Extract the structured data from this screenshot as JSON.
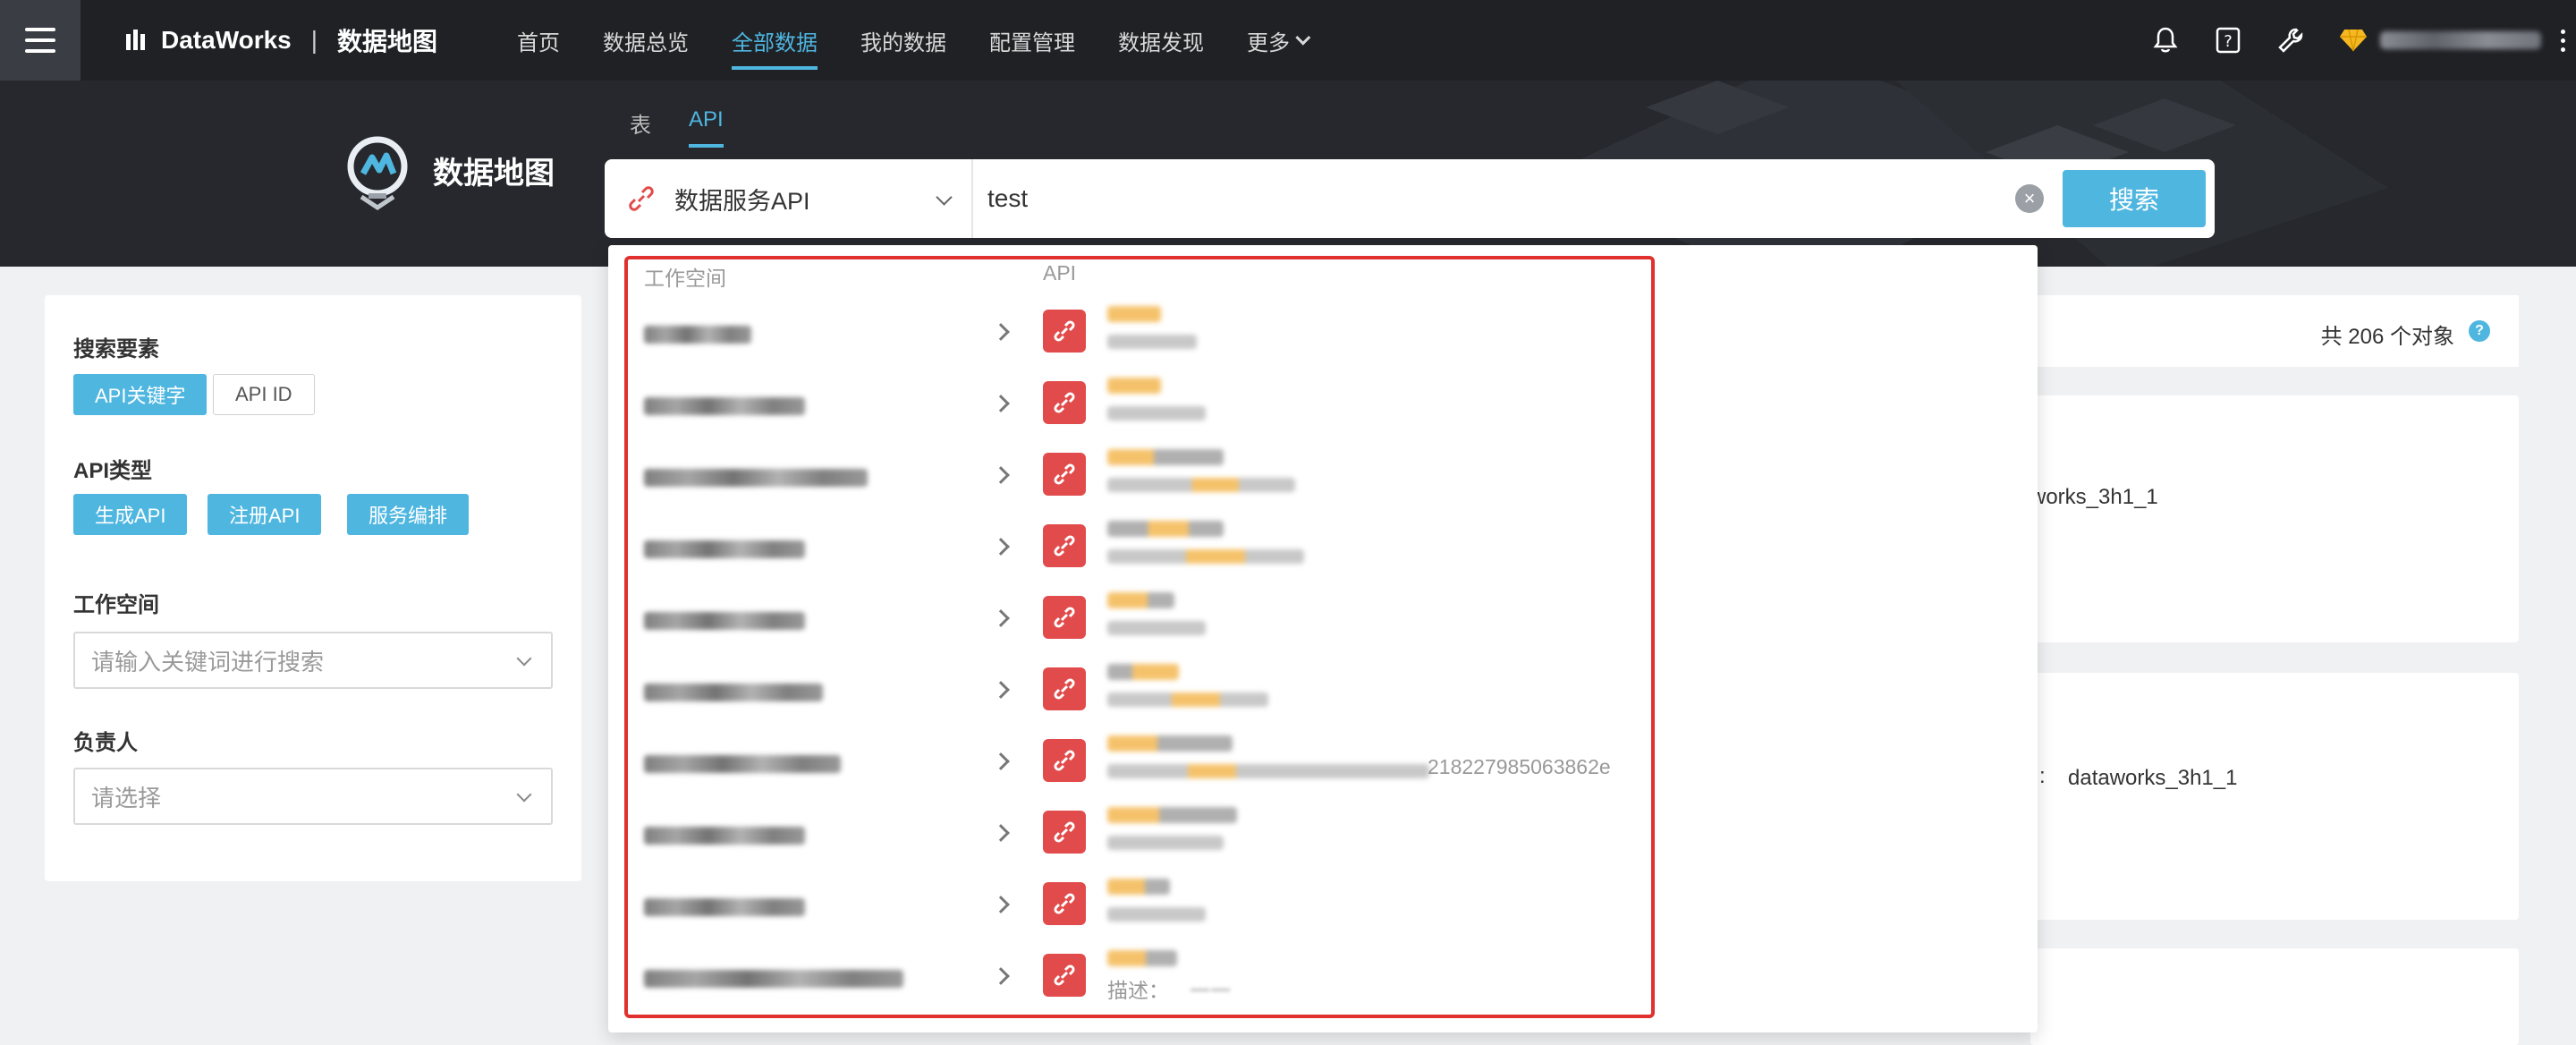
{
  "topbar": {
    "brand": "DataWorks",
    "separator": "|",
    "product": "数据地图",
    "nav": [
      "首页",
      "数据总览",
      "全部数据",
      "我的数据",
      "配置管理",
      "数据发现",
      "更多"
    ],
    "active_nav": "全部数据",
    "icons": [
      "bell-icon",
      "help-icon",
      "wrench-icon",
      "diamond-icon"
    ]
  },
  "banner": {
    "title": "数据地图",
    "tabs": [
      "表",
      "API"
    ],
    "active_tab": "API",
    "type_select": "数据服务API",
    "search_value": "test",
    "search_button": "搜索"
  },
  "filter": {
    "keyword_title": "搜索要素",
    "keyword_chips": [
      "API关键字",
      "API ID"
    ],
    "type_title": "API类型",
    "type_chips": [
      "生成API",
      "注册API",
      "服务编排"
    ],
    "workspace_title": "工作空间",
    "workspace_placeholder": "请输入关键词进行搜索",
    "owner_title": "负责人",
    "owner_placeholder": "请选择"
  },
  "results": {
    "count_text": "共 206 个对象",
    "ws1": "works_3h1_1",
    "ws2_label": ":",
    "ws2": "dataworks_3h1_1"
  },
  "dropdown": {
    "col_workspace": "工作空间",
    "col_api": "API",
    "row7_desc_tail": "218227985063862e",
    "row10_desc_label": "描述：",
    "row10_desc_tail": "一一"
  },
  "colors": {
    "accent": "#4fb6e0",
    "topbar": "#1f2125",
    "highlight": "#e0312e",
    "api_icon": "#e24b4b"
  }
}
